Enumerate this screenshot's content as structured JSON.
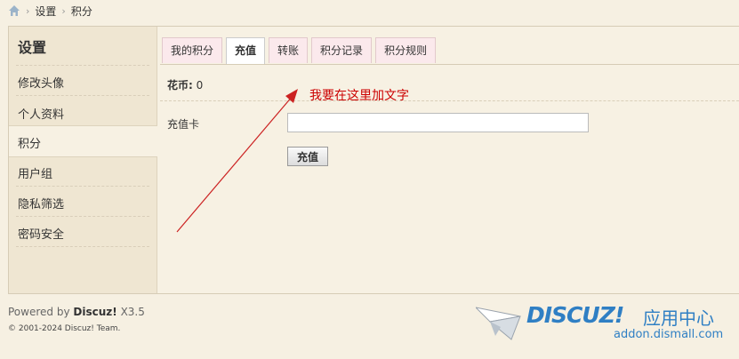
{
  "breadcrumb": {
    "home_icon": "home-icon",
    "items": [
      "设置",
      "积分"
    ]
  },
  "sidebar": {
    "title": "设置",
    "items": [
      {
        "label": "修改头像"
      },
      {
        "label": "个人资料"
      },
      {
        "label": "积分",
        "active": true
      },
      {
        "label": "用户组"
      },
      {
        "label": "隐私筛选"
      },
      {
        "label": "密码安全"
      }
    ]
  },
  "tabs": [
    {
      "label": "我的积分"
    },
    {
      "label": "充值",
      "active": true
    },
    {
      "label": "转账"
    },
    {
      "label": "积分记录"
    },
    {
      "label": "积分规则"
    }
  ],
  "main": {
    "coins_label": "花币:",
    "coins_value": "0",
    "annotation": "我要在这里加文字",
    "card_label": "充值卡",
    "card_value": "",
    "submit_label": "充值"
  },
  "footer": {
    "powered_prefix": "Powered by",
    "powered_brand": "Discuz!",
    "powered_version": "X3.5",
    "copyright": "© 2001-2024 Discuz! Team."
  },
  "logo": {
    "brand": "DISCUZ!",
    "cn_text": "应用中心",
    "url": "addon.dismall.com"
  },
  "colors": {
    "annotation": "#cc0000",
    "logo_blue": "#2f7fc4",
    "page_bg": "#f6f0e2"
  }
}
